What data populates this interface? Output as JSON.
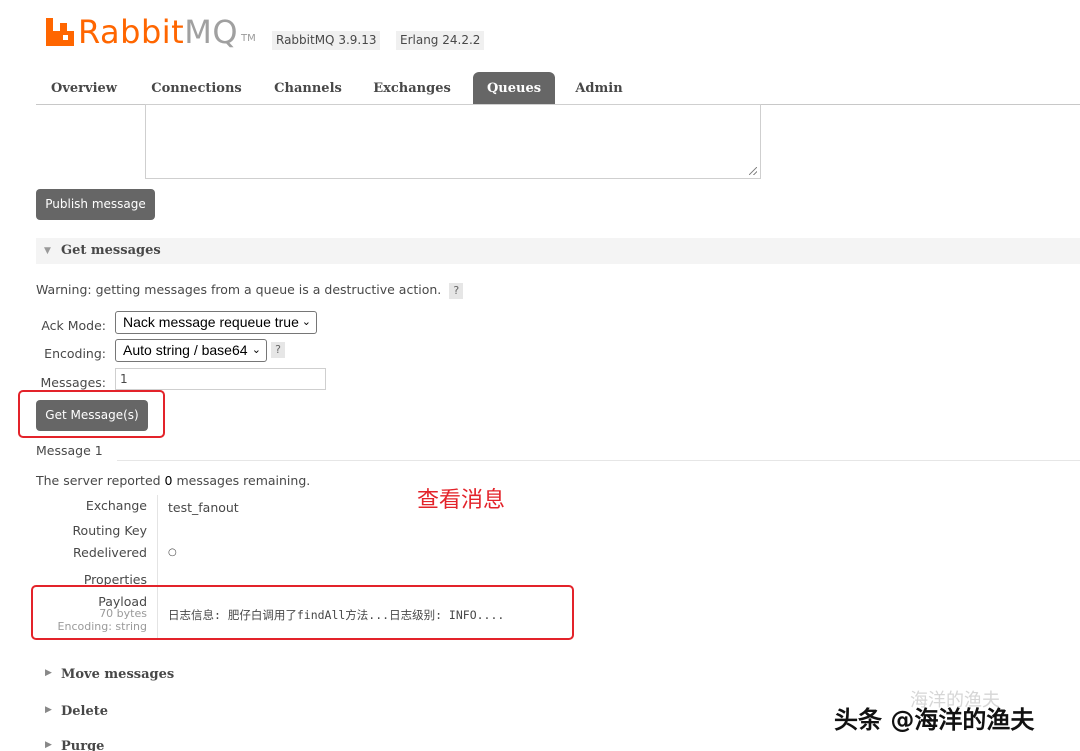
{
  "header": {
    "logo_brand": "Rabbit",
    "logo_mq": "MQ",
    "logo_tm": "TM",
    "rabbitmq_version": "RabbitMQ 3.9.13",
    "erlang_version": "Erlang 24.2.2"
  },
  "tabs": [
    {
      "label": "Overview"
    },
    {
      "label": "Connections"
    },
    {
      "label": "Channels"
    },
    {
      "label": "Exchanges"
    },
    {
      "label": "Queues"
    },
    {
      "label": "Admin"
    }
  ],
  "active_tab": "Queues",
  "publish": {
    "button_label": "Publish message"
  },
  "get_messages": {
    "title": "Get messages",
    "warning": "Warning: getting messages from a queue is a destructive action.",
    "help_glyph": "?",
    "ack_mode_label": "Ack Mode:",
    "ack_mode_value": "Nack message requeue true",
    "encoding_label": "Encoding:",
    "encoding_value": "Auto string / base64",
    "messages_label": "Messages:",
    "messages_value": "1",
    "button_label": "Get Message(s)"
  },
  "message": {
    "heading": "Message 1",
    "server_reported_prefix": "The server reported ",
    "remaining_count": "0",
    "server_reported_suffix": " messages remaining.",
    "exchange_label": "Exchange",
    "exchange_value": "test_fanout",
    "routing_key_label": "Routing Key",
    "redelivered_label": "Redelivered",
    "redelivered_value": "○",
    "properties_label": "Properties",
    "payload_label": "Payload",
    "payload_size": "70 bytes",
    "payload_encoding": "Encoding: string",
    "payload_value": "日志信息: 肥仔白调用了findAll方法...日志级别: INFO...."
  },
  "annotation": "查看消息",
  "sections": [
    {
      "title": "Move messages"
    },
    {
      "title": "Delete"
    },
    {
      "title": "Purge"
    }
  ],
  "watermark": {
    "main": "头条 @海洋的渔夫",
    "faint": "海洋的渔夫"
  },
  "colors": {
    "brand_orange": "#ff6600",
    "tab_active_bg": "#666666",
    "annotation_red": "#e3232a"
  }
}
